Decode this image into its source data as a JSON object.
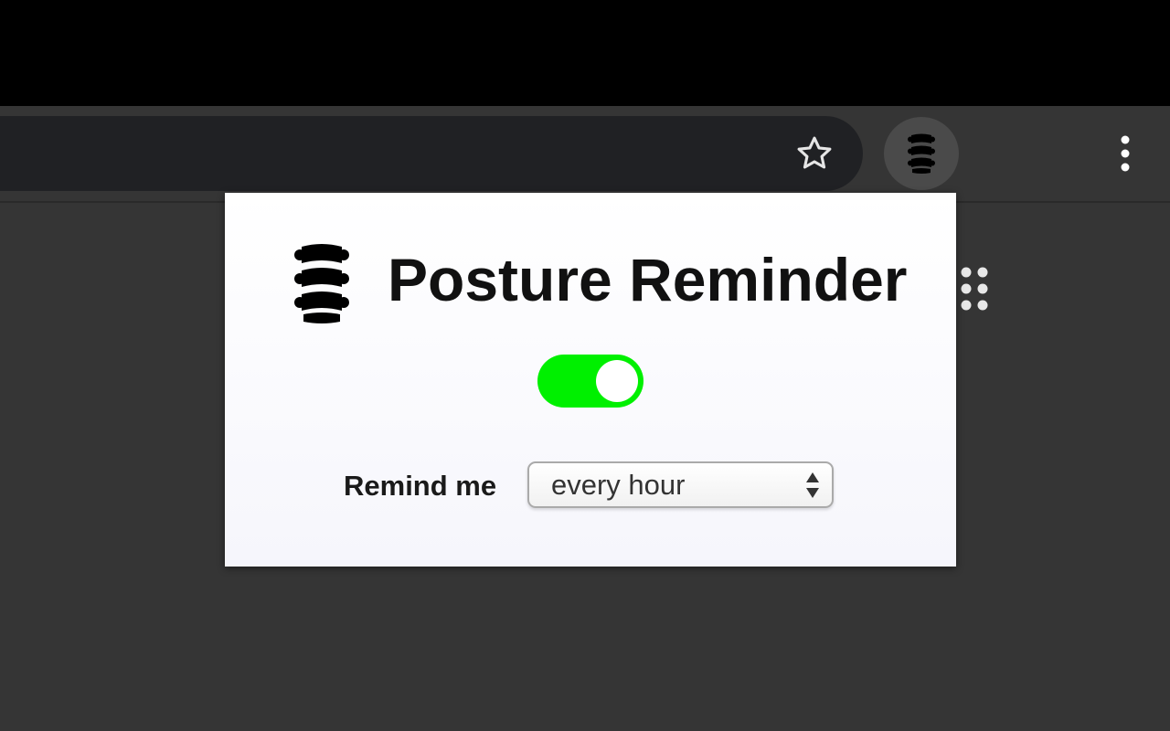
{
  "browser": {
    "star_icon": "star-outline-icon",
    "extension_icon": "spine-icon",
    "menu_icon": "vertical-ellipsis-icon",
    "apps_icon": "apps-grid-icon"
  },
  "popup": {
    "title": "Posture Reminder",
    "title_icon": "spine-icon",
    "toggle_on": true,
    "toggle_color": "#00f000",
    "remind_label": "Remind me",
    "interval_selected": "every hour"
  }
}
